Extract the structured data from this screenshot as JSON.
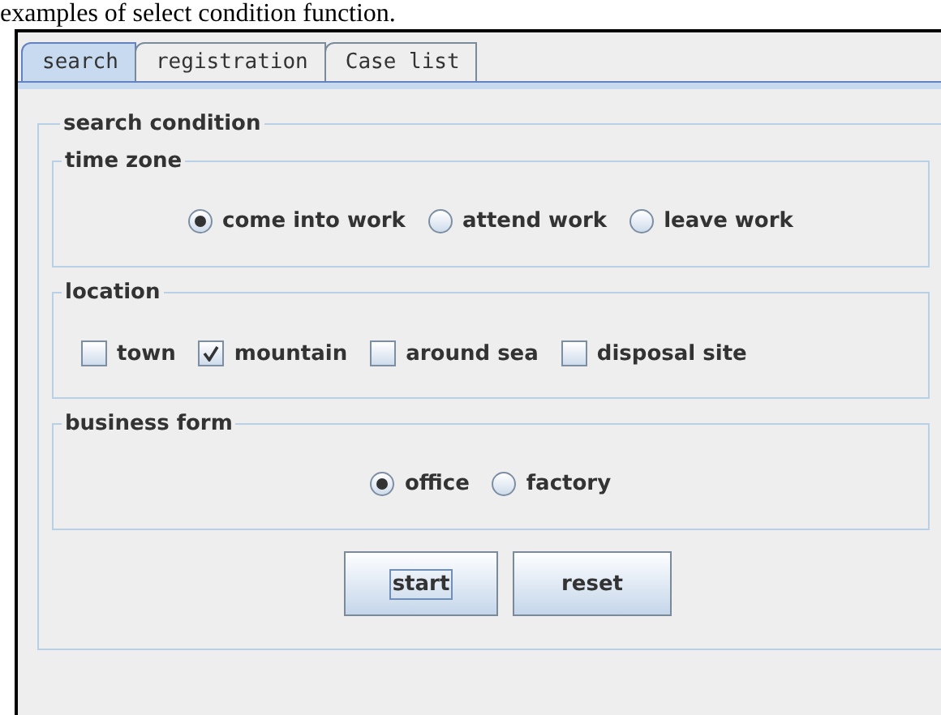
{
  "caption": "examples of select condition function.",
  "tabs": [
    {
      "label": "search",
      "selected": true
    },
    {
      "label": "registration",
      "selected": false
    },
    {
      "label": "Case list",
      "selected": false
    }
  ],
  "search_condition": {
    "title": "search condition",
    "groups": [
      {
        "title": "time zone",
        "kind": "radio",
        "items": [
          {
            "label": "come into work",
            "selected": true
          },
          {
            "label": "attend work",
            "selected": false
          },
          {
            "label": "leave work",
            "selected": false
          }
        ]
      },
      {
        "title": "location",
        "kind": "checkbox",
        "items": [
          {
            "label": "town",
            "checked": false
          },
          {
            "label": "mountain",
            "checked": true
          },
          {
            "label": "around sea",
            "checked": false
          },
          {
            "label": "disposal site",
            "checked": false
          }
        ]
      },
      {
        "title": "business form",
        "kind": "radio",
        "items": [
          {
            "label": "office",
            "selected": true
          },
          {
            "label": "factory",
            "selected": false
          }
        ]
      }
    ],
    "buttons": [
      {
        "label": "start",
        "focused": true
      },
      {
        "label": "reset",
        "focused": false
      }
    ]
  }
}
